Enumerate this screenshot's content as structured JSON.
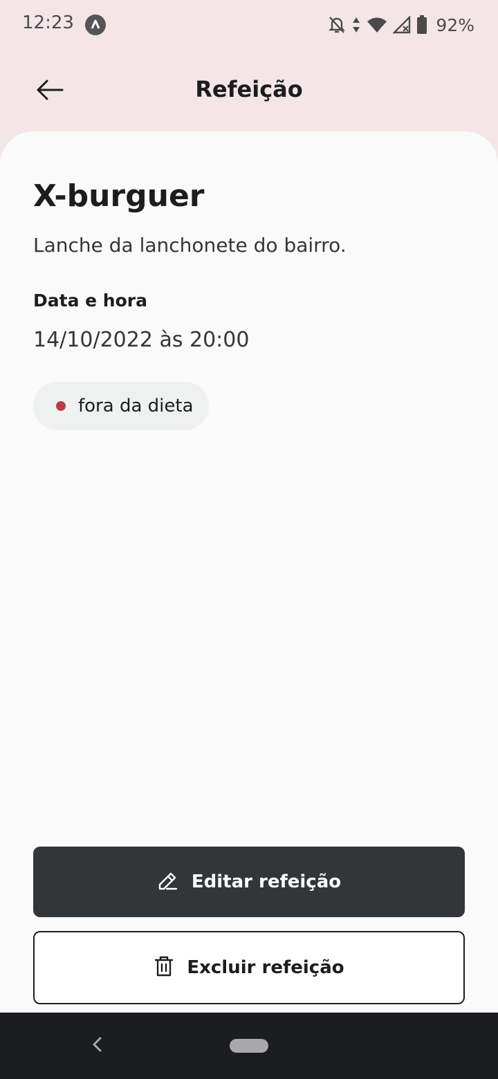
{
  "status_bar": {
    "time": "12:23",
    "battery": "92%",
    "icons": [
      "app-notification-icon",
      "bell-off-icon",
      "data-arrows-icon",
      "wifi-icon",
      "signal-icon",
      "battery-icon"
    ]
  },
  "header": {
    "title": "Refeição",
    "back_icon": "arrow-left-icon"
  },
  "meal": {
    "name": "X-burguer",
    "description": "Lanche da lanchonete do bairro.",
    "date_label": "Data e hora",
    "date_value": "14/10/2022 às 20:00",
    "status_label": "fora da dieta",
    "status_color": "#BF3B44"
  },
  "actions": {
    "edit_label": "Editar refeição",
    "edit_icon": "pencil-icon",
    "delete_label": "Excluir refeição",
    "delete_icon": "trash-icon"
  },
  "colors": {
    "header_bg": "#F4E6E7",
    "card_bg": "#FAFAFA",
    "primary_button": "#333638",
    "nav_bar": "#1C1D1F"
  }
}
